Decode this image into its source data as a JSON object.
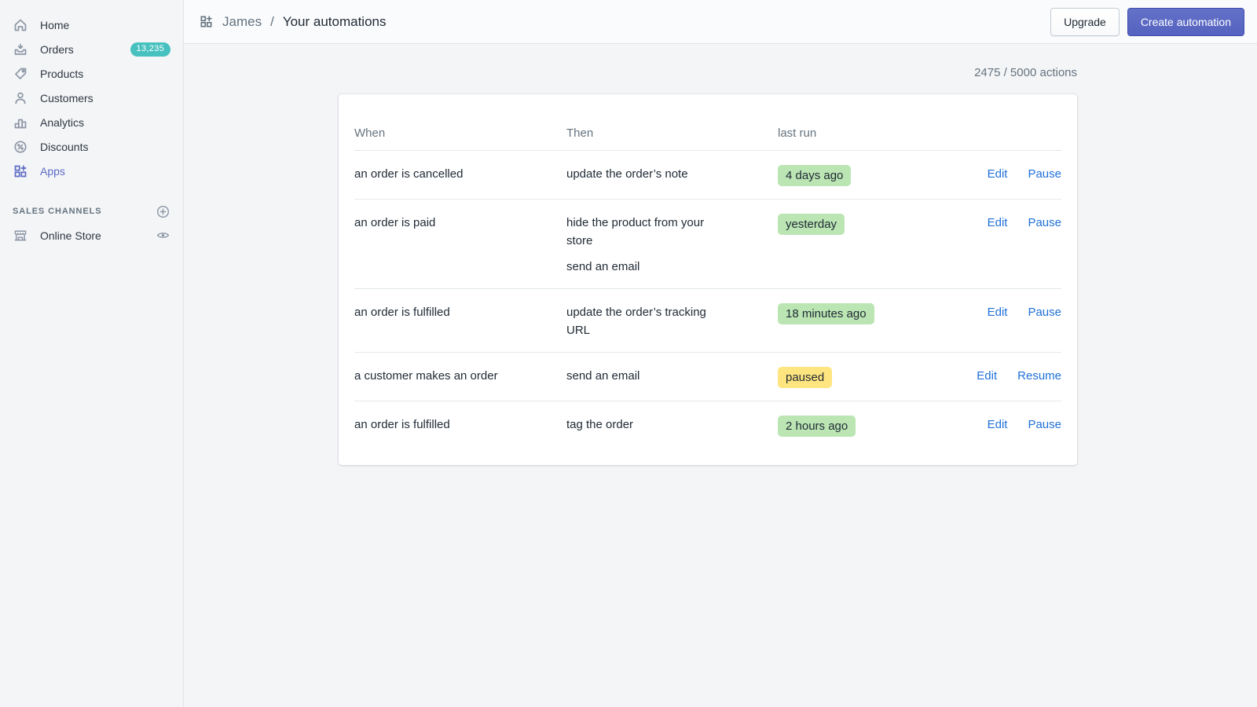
{
  "colors": {
    "accent_indigo": "#5c6ac4",
    "badge_teal": "#47c1bf",
    "badge_green": "#bbe5b3",
    "badge_yellow": "#ffe57f",
    "link_blue": "#1f70d8",
    "background": "#f4f5f7"
  },
  "sidebar": {
    "items": [
      {
        "label": "Home",
        "icon": "home-icon"
      },
      {
        "label": "Orders",
        "icon": "orders-icon",
        "badge": "13,235"
      },
      {
        "label": "Products",
        "icon": "tag-icon"
      },
      {
        "label": "Customers",
        "icon": "customers-icon"
      },
      {
        "label": "Analytics",
        "icon": "analytics-icon"
      },
      {
        "label": "Discounts",
        "icon": "discounts-icon"
      },
      {
        "label": "Apps",
        "icon": "apps-icon",
        "active": true
      }
    ],
    "sales_channels": {
      "heading": "SALES CHANNELS",
      "items": [
        {
          "label": "Online Store",
          "icon": "storefront-icon"
        }
      ]
    }
  },
  "header": {
    "breadcrumb": {
      "app": "James",
      "separator": "/",
      "current": "Your automations"
    },
    "buttons": {
      "upgrade": "Upgrade",
      "create": "Create automation"
    }
  },
  "main": {
    "actions_counter": "2475 / 5000 actions",
    "table": {
      "columns": {
        "when": "When",
        "then": "Then",
        "last_run": "last run"
      },
      "rows": [
        {
          "when": "an order is cancelled",
          "then": [
            "update the order’s note"
          ],
          "last_run": "4 days ago",
          "status": "active",
          "actions": [
            "Edit",
            "Pause"
          ]
        },
        {
          "when": "an order is paid",
          "then": [
            "hide the product from your store",
            "send an email"
          ],
          "last_run": "yesterday",
          "status": "active",
          "actions": [
            "Edit",
            "Pause"
          ]
        },
        {
          "when": "an order is fulfilled",
          "then": [
            "update the order’s tracking URL"
          ],
          "last_run": "18 minutes ago",
          "status": "active",
          "actions": [
            "Edit",
            "Pause"
          ]
        },
        {
          "when": "a customer makes an order",
          "then": [
            "send an email"
          ],
          "last_run": "paused",
          "status": "paused",
          "actions": [
            "Edit",
            "Resume"
          ]
        },
        {
          "when": "an order is fulfilled",
          "then": [
            "tag the order"
          ],
          "last_run": "2 hours ago",
          "status": "active",
          "actions": [
            "Edit",
            "Pause"
          ]
        }
      ]
    }
  }
}
